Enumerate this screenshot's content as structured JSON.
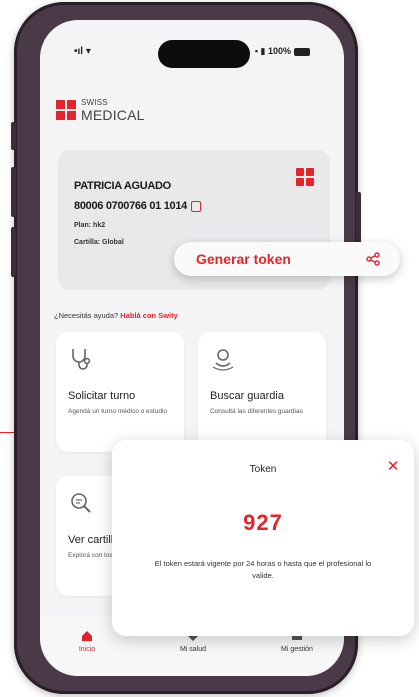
{
  "status_bar": {
    "signal": "•ıl ▾",
    "right": "▪ ▮ 100%"
  },
  "brand": {
    "line1": "SWISS",
    "line2": "MEDICAL"
  },
  "member_card": {
    "name": "PATRICIA AGUADO",
    "number": "80006 0700766 01 1014",
    "plan": "Plan: hk2",
    "cartilla": "Cartilla: Global"
  },
  "token_pill": {
    "label": "Generar token",
    "share_icon": "share-icon"
  },
  "help": {
    "question": "¿Necesitás ayuda?",
    "link": "Hablá con Swity"
  },
  "tiles": [
    {
      "title": "Solicitar turno",
      "desc": "Agendá un turno médico o estudio",
      "icon": "stethoscope-icon"
    },
    {
      "title": "Buscar guardia",
      "desc": "Consultá las diferentes guardias",
      "icon": "location-icon"
    },
    {
      "title": "Ver cartilla",
      "desc": "Explorá con los profesionales",
      "icon": "search-doc-icon"
    }
  ],
  "nav": [
    {
      "label": "Inicio",
      "icon": "home-icon"
    },
    {
      "label": "Mi salud",
      "icon": "heart-icon"
    },
    {
      "label": "Mi gestión",
      "icon": "folder-icon"
    }
  ],
  "token_modal": {
    "title": "Token",
    "value": "927",
    "message": "El token estará vigente por 24 horas o hasta que el profesional lo valide.",
    "close": "✕"
  },
  "colors": {
    "accent": "#e1252b",
    "phone_frame": "#4a3a47",
    "screen_bg": "#f4f4f6"
  }
}
